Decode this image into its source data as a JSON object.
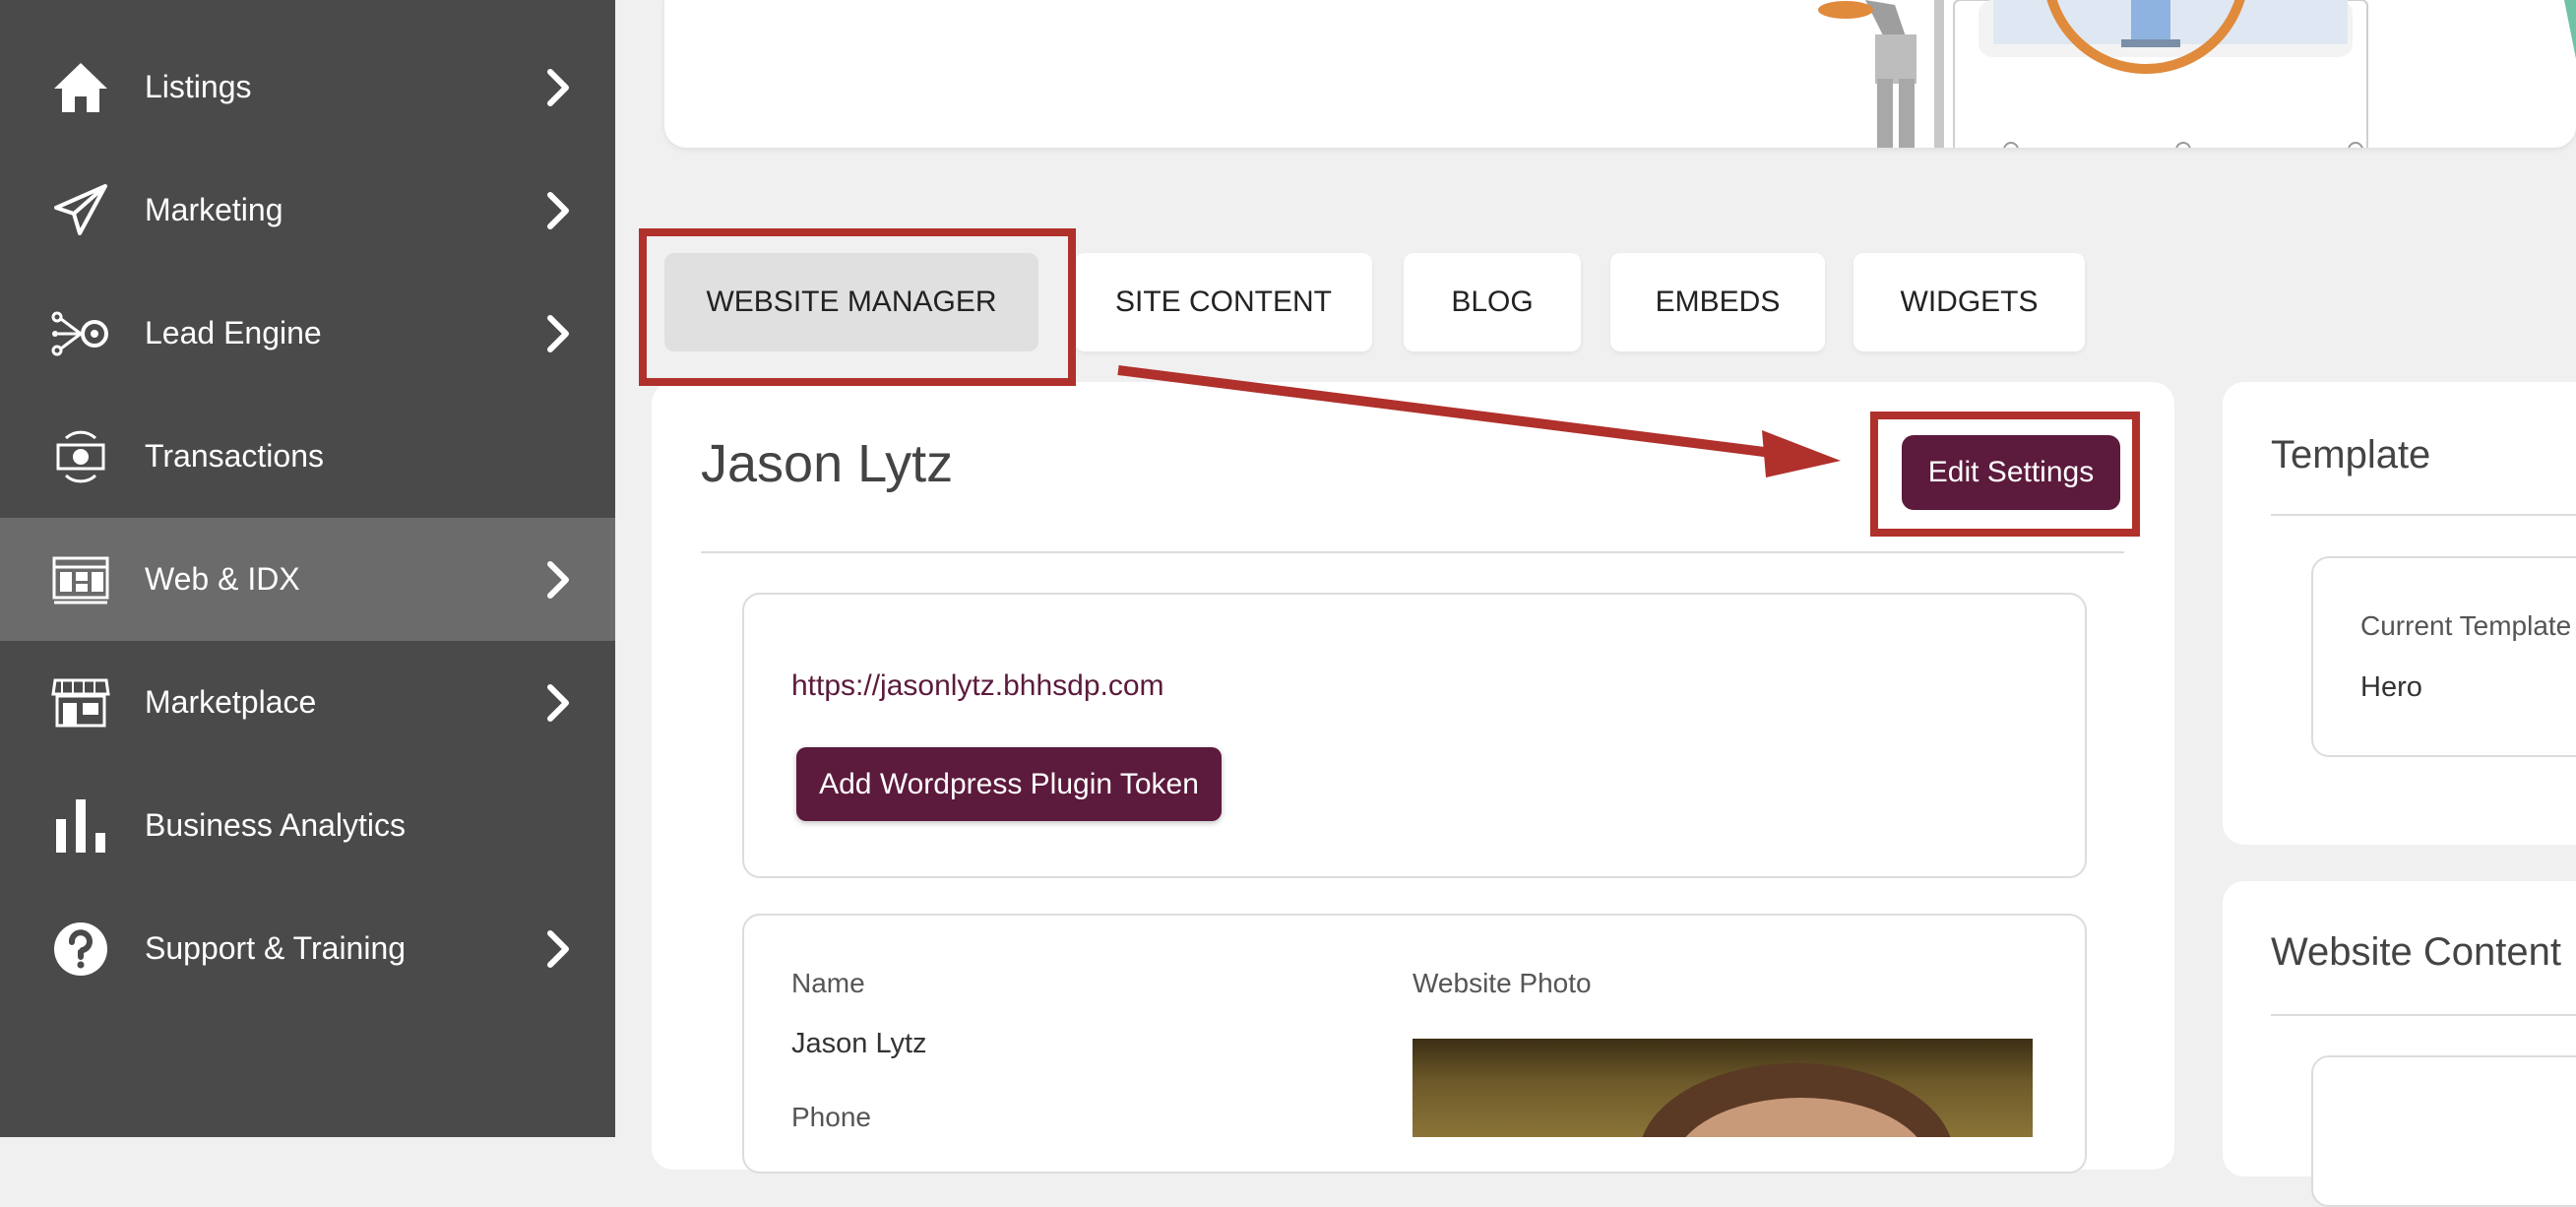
{
  "sidebar": {
    "items": [
      {
        "label": "Listings",
        "icon": "home-icon",
        "has_arrow": true
      },
      {
        "label": "Marketing",
        "icon": "paper-plane-icon",
        "has_arrow": true
      },
      {
        "label": "Lead Engine",
        "icon": "lead-engine-icon",
        "has_arrow": true
      },
      {
        "label": "Transactions",
        "icon": "money-cycle-icon",
        "has_arrow": false
      },
      {
        "label": "Web & IDX",
        "icon": "website-icon",
        "has_arrow": true,
        "active": true
      },
      {
        "label": "Marketplace",
        "icon": "storefront-icon",
        "has_arrow": true
      },
      {
        "label": "Business Analytics",
        "icon": "bar-chart-icon",
        "has_arrow": false
      },
      {
        "label": "Support & Training",
        "icon": "question-circle-icon",
        "has_arrow": true
      }
    ]
  },
  "tabs": [
    {
      "label": "WEBSITE MANAGER",
      "selected": true
    },
    {
      "label": "SITE CONTENT"
    },
    {
      "label": "BLOG"
    },
    {
      "label": "EMBEDS"
    },
    {
      "label": "WIDGETS"
    }
  ],
  "website": {
    "owner_name": "Jason Lytz",
    "edit_settings_label": "Edit Settings",
    "url": "https://jasonlytz.bhhsdp.com",
    "plugin_button_label": "Add Wordpress Plugin Token"
  },
  "profile": {
    "name_label": "Name",
    "name_value": "Jason Lytz",
    "phone_label": "Phone",
    "photo_label": "Website Photo"
  },
  "template": {
    "title": "Template",
    "current_label": "Current Template",
    "current_value": "Hero"
  },
  "website_content": {
    "title": "Website Content"
  },
  "colors": {
    "sidebar_bg": "#4a4a4a",
    "sidebar_active": "#6b6b6b",
    "brand": "#5c1a3c",
    "annotation_red": "#b0302b"
  }
}
